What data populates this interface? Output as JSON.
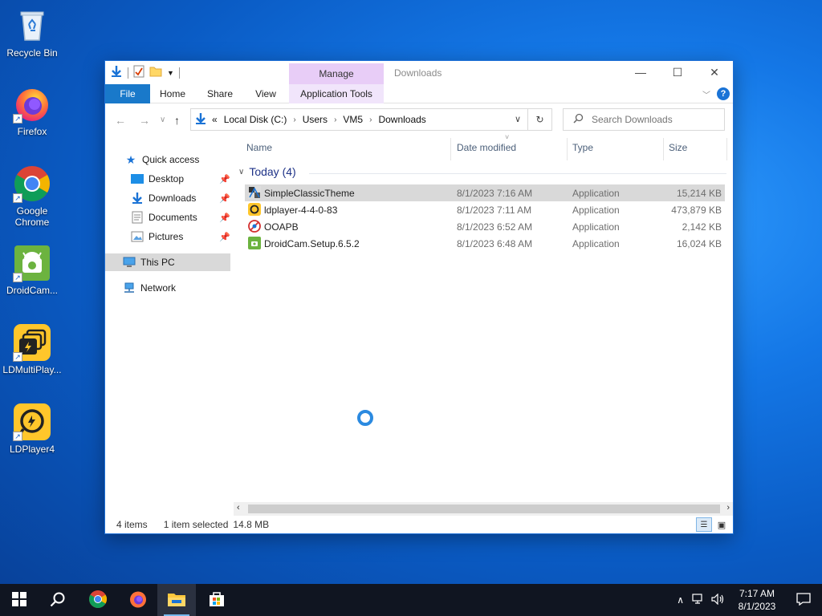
{
  "desktop": {
    "icons": [
      {
        "label": "Recycle Bin",
        "icon": "recycle-bin-icon"
      },
      {
        "label": "Firefox",
        "icon": "firefox-icon"
      },
      {
        "label": "Google Chrome",
        "icon": "chrome-icon"
      },
      {
        "label": "DroidCam...",
        "icon": "droidcam-icon"
      },
      {
        "label": "LDMultiPlay...",
        "icon": "ldmultiplayer-icon"
      },
      {
        "label": "LDPlayer4",
        "icon": "ldplayer-icon"
      }
    ]
  },
  "window": {
    "title": "Downloads",
    "manage_tab": "Manage",
    "ribbon_tabs": [
      "File",
      "Home",
      "Share",
      "View",
      "Application Tools"
    ],
    "controls": {
      "minimize": "—",
      "maximize": "☐",
      "close": "✕"
    },
    "help": "?"
  },
  "address": {
    "overflow": "«",
    "crumbs": [
      "Local Disk (C:)",
      "Users",
      "VM5",
      "Downloads"
    ],
    "search_placeholder": "Search Downloads"
  },
  "nav": {
    "quick_access": "Quick access",
    "items": [
      {
        "label": "Desktop",
        "pinned": true
      },
      {
        "label": "Downloads",
        "pinned": true
      },
      {
        "label": "Documents",
        "pinned": true
      },
      {
        "label": "Pictures",
        "pinned": true
      }
    ],
    "this_pc": "This PC",
    "network": "Network"
  },
  "columns": [
    "Name",
    "Date modified",
    "Type",
    "Size"
  ],
  "group": {
    "label": "Today (4)"
  },
  "files": [
    {
      "name": "SimpleClassicTheme",
      "date": "8/1/2023 7:16 AM",
      "type": "Application",
      "size": "15,214 KB",
      "selected": true
    },
    {
      "name": "ldplayer-4-4-0-83",
      "date": "8/1/2023 7:11 AM",
      "type": "Application",
      "size": "473,879 KB",
      "selected": false
    },
    {
      "name": "OOAPB",
      "date": "8/1/2023 6:52 AM",
      "type": "Application",
      "size": "2,142 KB",
      "selected": false
    },
    {
      "name": "DroidCam.Setup.6.5.2",
      "date": "8/1/2023 6:48 AM",
      "type": "Application",
      "size": "16,024 KB",
      "selected": false
    }
  ],
  "status": {
    "count": "4 items",
    "selected": "1 item selected",
    "size": "14.8 MB"
  },
  "taskbar": {
    "time": "7:17 AM",
    "date": "8/1/2023"
  },
  "colors": {
    "accent": "#1979ca",
    "manage": "#e8cdf7",
    "selection": "#d9d9d9",
    "group_text": "#1e3287"
  }
}
